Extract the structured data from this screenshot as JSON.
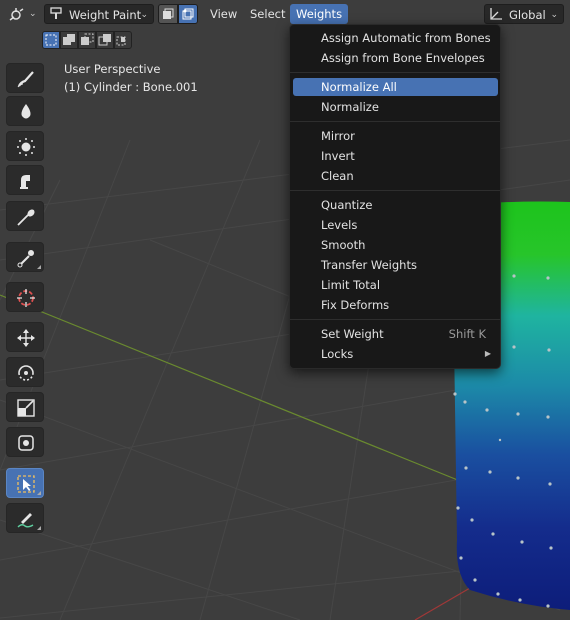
{
  "header": {
    "editor_type_icon": "editor-type-icon",
    "mode_label": "Weight Paint",
    "mode_icon": "weight-paint-icon",
    "menus": [
      "View",
      "Select",
      "Weights"
    ],
    "active_menu": "Weights",
    "transform_orientation": "Global",
    "orientation_icon": "transform-orientation-icon"
  },
  "viewport": {
    "view_name": "User Perspective",
    "object_info": "(1) Cylinder : Bone.001"
  },
  "toolbar": {
    "tools": [
      {
        "name": "draw-brush-icon"
      },
      {
        "name": "blur-brush-icon"
      },
      {
        "name": "average-brush-icon"
      },
      {
        "name": "smear-brush-icon"
      },
      {
        "name": "gradient-tool-icon"
      },
      {
        "name": "sample-weight-icon"
      },
      {
        "name": "cursor-icon"
      },
      {
        "name": "move-icon"
      },
      {
        "name": "rotate-icon"
      },
      {
        "name": "scale-icon"
      },
      {
        "name": "transform-icon"
      },
      {
        "name": "select-box-icon",
        "active": true
      },
      {
        "name": "annotate-icon"
      }
    ]
  },
  "weights_menu": {
    "items": [
      {
        "label": "Assign Automatic from Bones"
      },
      {
        "label": "Assign from Bone Envelopes"
      },
      {
        "label": "Normalize All",
        "highlight": true
      },
      {
        "label": "Normalize"
      },
      {
        "label": "Mirror"
      },
      {
        "label": "Invert"
      },
      {
        "label": "Clean"
      },
      {
        "label": "Quantize"
      },
      {
        "label": "Levels"
      },
      {
        "label": "Smooth"
      },
      {
        "label": "Transfer Weights"
      },
      {
        "label": "Limit Total"
      },
      {
        "label": "Fix Deforms"
      },
      {
        "label": "Set Weight",
        "shortcut": "Shift K"
      },
      {
        "label": "Locks",
        "submenu": true
      }
    ]
  },
  "colors": {
    "accent": "#4772b3",
    "viewport_bg": "#3d3d3d",
    "menu_bg": "#181818",
    "weight_high": "#1fc21f",
    "weight_mid": "#1f9fa0",
    "weight_low": "#10207a"
  }
}
